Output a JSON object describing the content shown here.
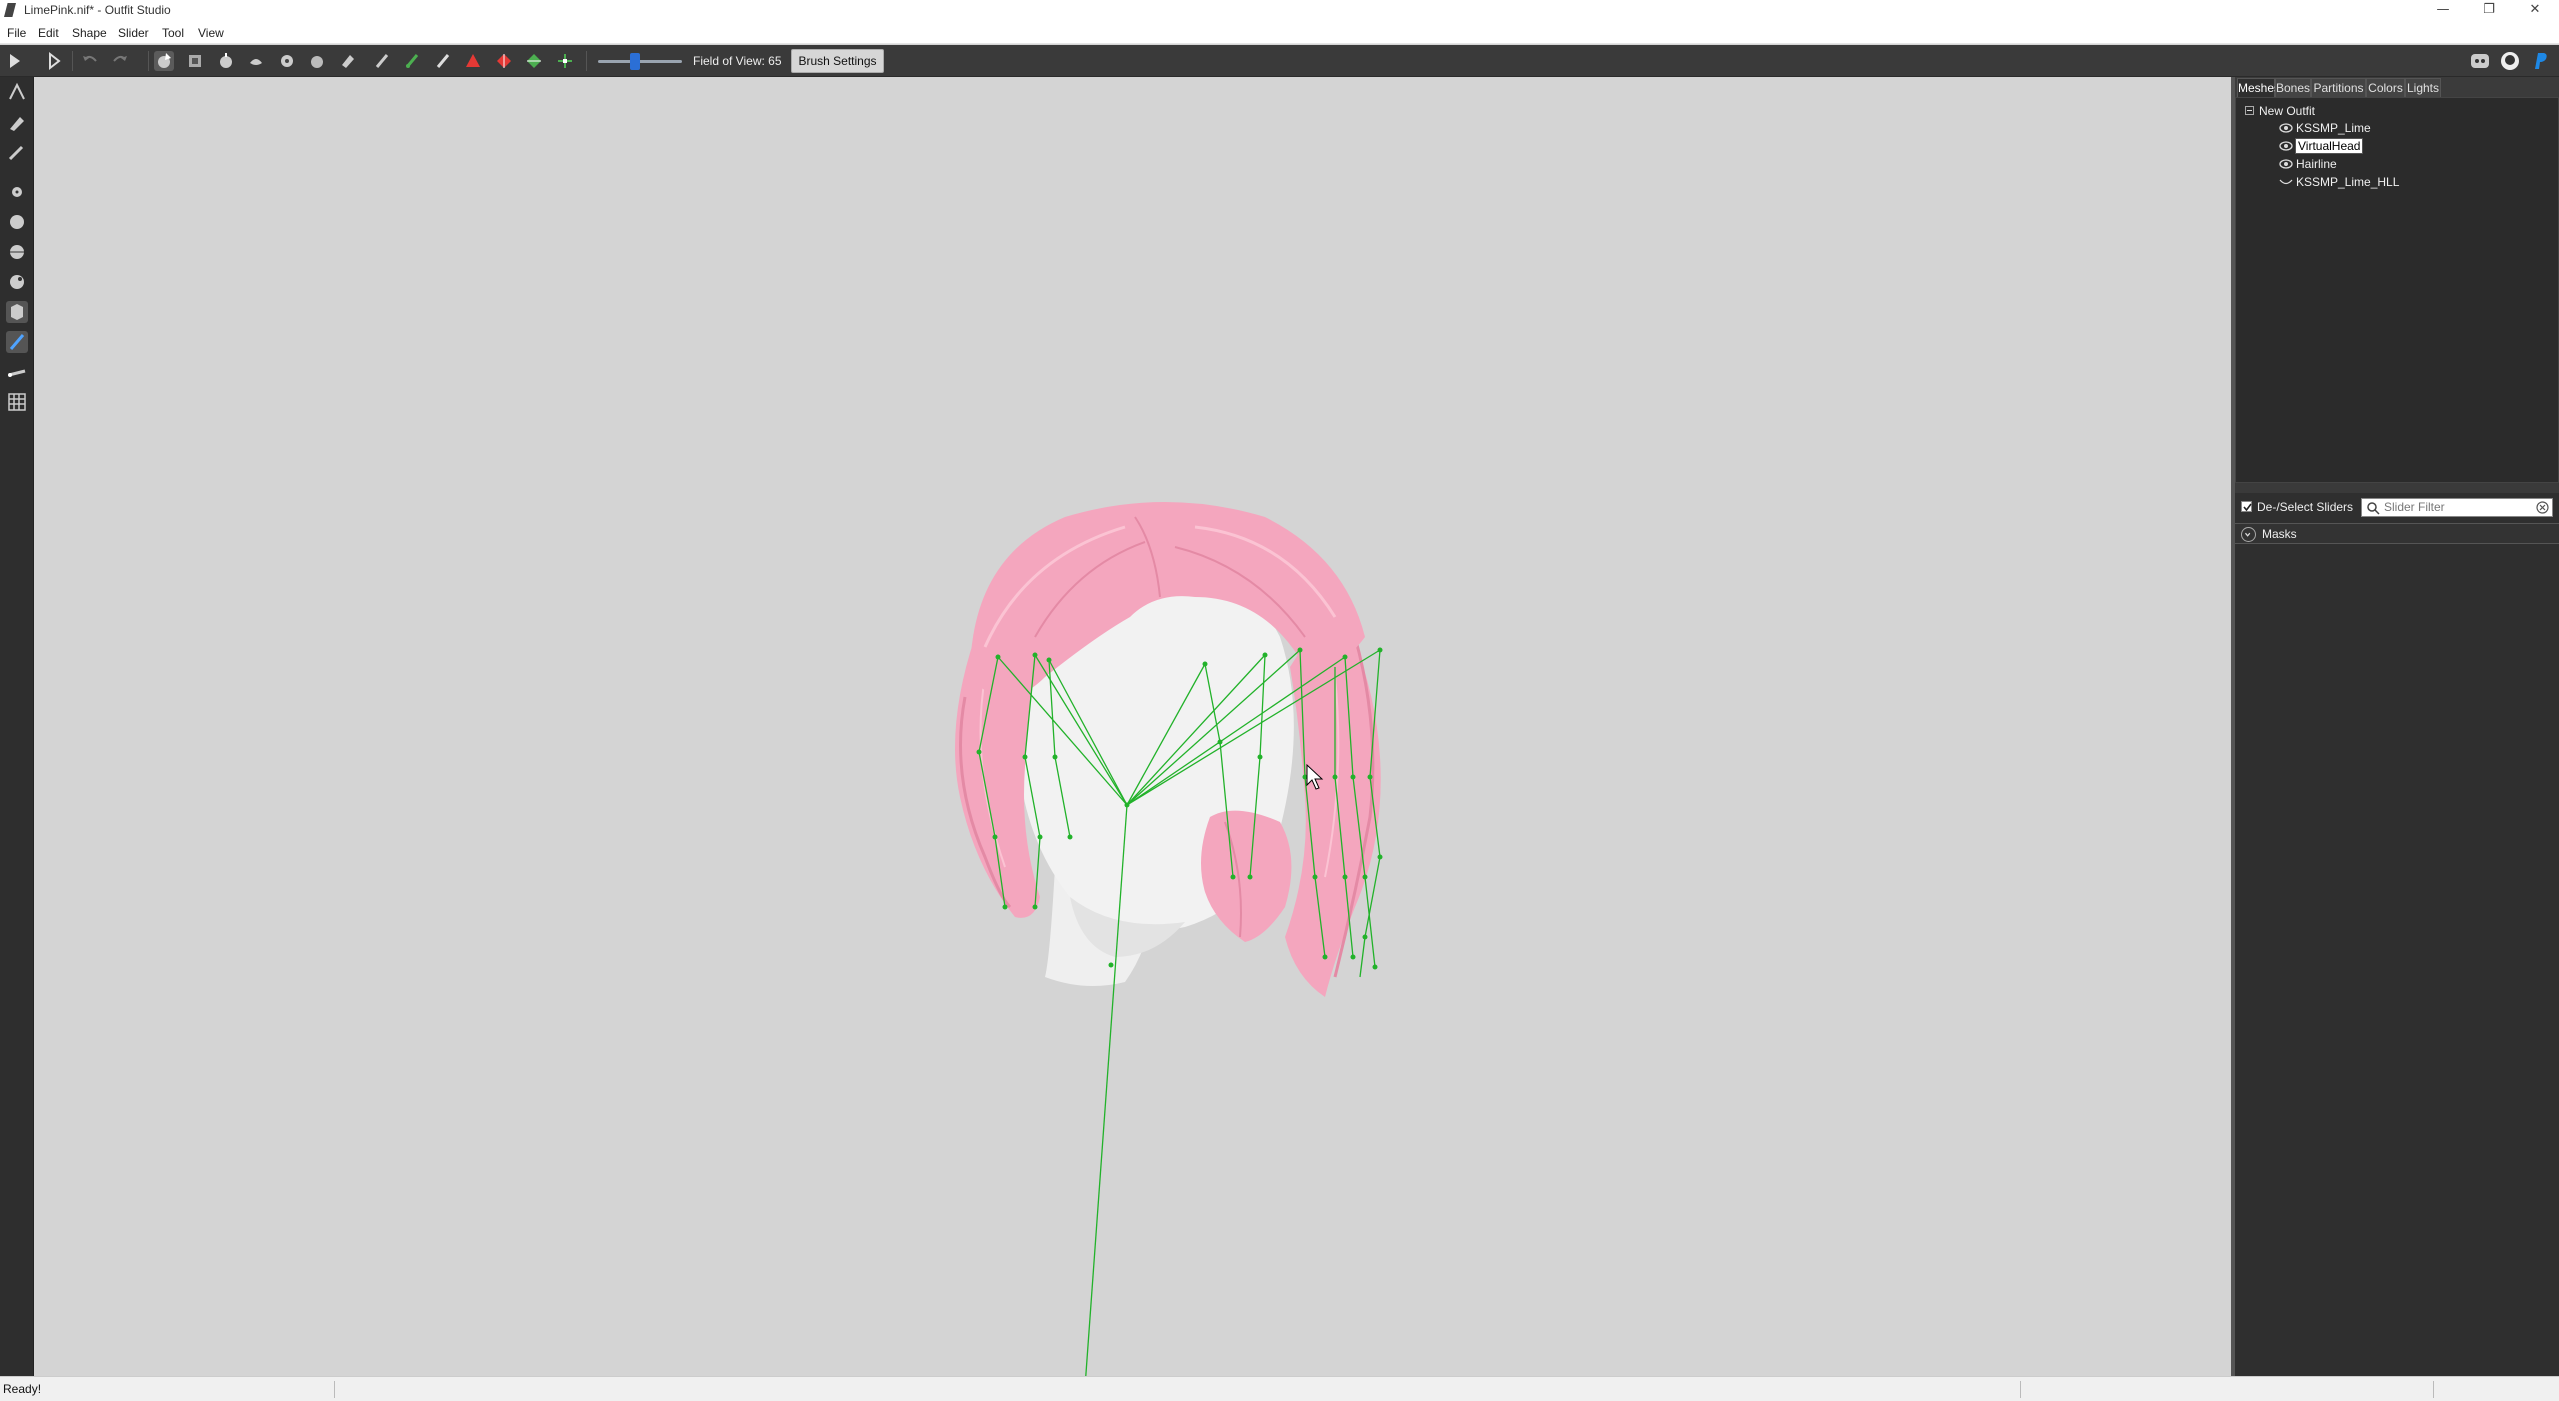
{
  "window": {
    "title": "LimePink.nif* - Outfit Studio",
    "controls": [
      "—",
      "❐",
      "✕"
    ]
  },
  "menu": [
    "File",
    "Edit",
    "Shape",
    "Slider",
    "Tool",
    "View"
  ],
  "toolbar": {
    "fov_label": "Field of View: 65",
    "fov_value": 65,
    "brush_settings": "Brush Settings"
  },
  "panel": {
    "tabs": [
      "Meshes",
      "Bones",
      "Partitions",
      "Colors",
      "Lights"
    ],
    "active_tab": "Meshes",
    "tree": {
      "root": "New Outfit",
      "items": [
        {
          "label": "KSSMP_Lime",
          "visible": true
        },
        {
          "label": "VirtualHead",
          "visible": true,
          "selected": true
        },
        {
          "label": "Hairline",
          "visible": true
        },
        {
          "label": "KSSMP_Lime_HLL",
          "visible": false
        }
      ]
    },
    "sliders": {
      "deselect_label": "De-/Select Sliders",
      "filter_placeholder": "Slider Filter",
      "groups": [
        "Masks"
      ]
    }
  },
  "status": {
    "text": "Ready!"
  },
  "colors": {
    "hair": "#f4a6be",
    "bones": "#22b22a",
    "head": "#f2f2f2",
    "viewport_bg": "#d4d4d4"
  }
}
